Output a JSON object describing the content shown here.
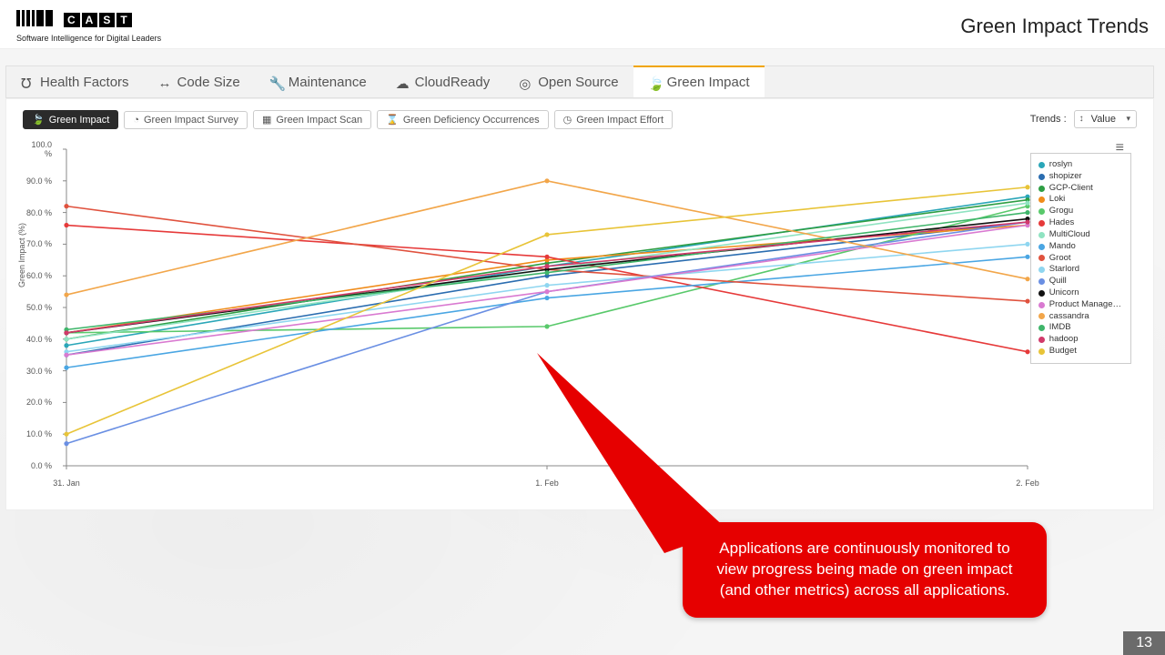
{
  "header": {
    "brand_letters": [
      "C",
      "A",
      "S",
      "T"
    ],
    "tagline": "Software Intelligence for Digital Leaders",
    "page_title": "Green Impact Trends"
  },
  "nav": [
    {
      "label": "Health Factors",
      "icon": "stethoscope"
    },
    {
      "label": "Code Size",
      "icon": "arrows-h"
    },
    {
      "label": "Maintenance",
      "icon": "wrench"
    },
    {
      "label": "CloudReady",
      "icon": "cloud"
    },
    {
      "label": "Open Source",
      "icon": "osi"
    },
    {
      "label": "Green Impact",
      "icon": "leaf",
      "active": true
    }
  ],
  "subtabs": [
    {
      "label": "Green Impact",
      "icon": "leaf",
      "active": true
    },
    {
      "label": "Green Impact Survey",
      "icon": "pie"
    },
    {
      "label": "Green Impact Scan",
      "icon": "grid"
    },
    {
      "label": "Green Deficiency Occurrences",
      "icon": "hourglass"
    },
    {
      "label": "Green Impact Effort",
      "icon": "clock"
    }
  ],
  "trends_label": "Trends :",
  "value_dropdown": "Value",
  "chart_data": {
    "type": "line",
    "title": "",
    "xlabel": "",
    "ylabel": "Green Impact (%)",
    "ylim": [
      0,
      100
    ],
    "x_categories": [
      "31. Jan",
      "1. Feb",
      "2. Feb"
    ],
    "y_ticks": [
      "0.0 %",
      "10.0 %",
      "20.0 %",
      "30.0 %",
      "40.0 %",
      "50.0 %",
      "60.0 %",
      "70.0 %",
      "80.0 %",
      "90.0 %",
      "100.0 %"
    ],
    "series": [
      {
        "name": "roslyn",
        "color": "#2aa6b8",
        "values": [
          38,
          63,
          85
        ]
      },
      {
        "name": "shopizer",
        "color": "#2b6db0",
        "values": [
          35,
          60,
          77
        ]
      },
      {
        "name": "GCP-Client",
        "color": "#2e9e44",
        "values": [
          40,
          64,
          84
        ]
      },
      {
        "name": "Loki",
        "color": "#f08c1a",
        "values": [
          42,
          65,
          76
        ]
      },
      {
        "name": "Grogu",
        "color": "#59c96b",
        "values": [
          42,
          44,
          82
        ]
      },
      {
        "name": "Hades",
        "color": "#e63a3a",
        "values": [
          76,
          66,
          36
        ]
      },
      {
        "name": "MultiCloud",
        "color": "#8fe3c1",
        "values": [
          40,
          62,
          83
        ]
      },
      {
        "name": "Mando",
        "color": "#4aa6e3",
        "values": [
          31,
          53,
          66
        ]
      },
      {
        "name": "Groot",
        "color": "#e0523e",
        "values": [
          82,
          62,
          52
        ]
      },
      {
        "name": "Starlord",
        "color": "#8fd6f0",
        "values": [
          36,
          57,
          70
        ]
      },
      {
        "name": "Quill",
        "color": "#6a8fe3",
        "values": [
          7,
          55,
          77
        ]
      },
      {
        "name": "Unicorn",
        "color": "#111111",
        "values": [
          42,
          62,
          78
        ]
      },
      {
        "name": "Product Manage…",
        "color": "#d97ad1",
        "values": [
          35,
          55,
          76
        ]
      },
      {
        "name": "cassandra",
        "color": "#f2a64a",
        "values": [
          54,
          90,
          59
        ]
      },
      {
        "name": "IMDB",
        "color": "#3fb56a",
        "values": [
          43,
          61,
          80
        ]
      },
      {
        "name": "hadoop",
        "color": "#d13a6a",
        "values": [
          42,
          63,
          77
        ]
      },
      {
        "name": "Budget",
        "color": "#e8c438",
        "values": [
          10,
          73,
          88
        ]
      }
    ]
  },
  "callout_text": "Applications are continuously monitored  to view progress being made on green impact  (and other metrics) across all applications.",
  "page_number": "13"
}
